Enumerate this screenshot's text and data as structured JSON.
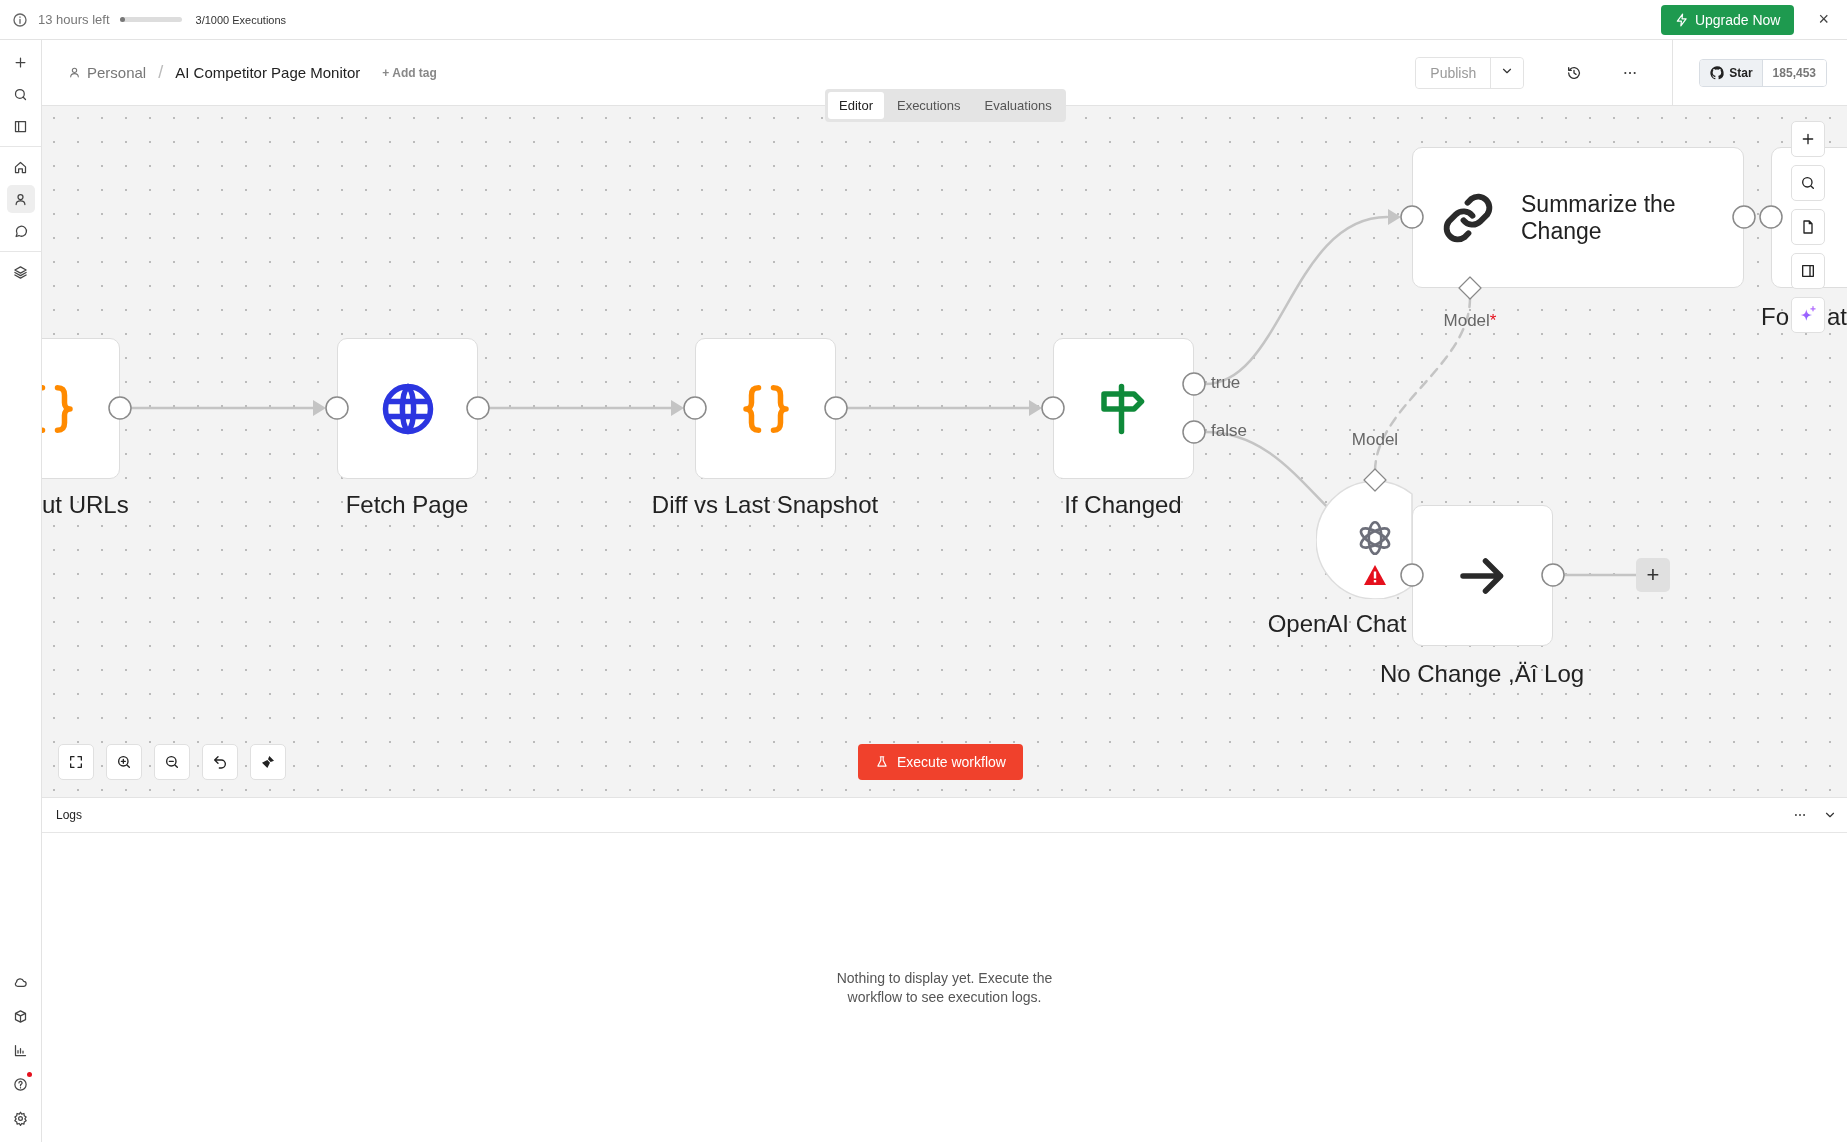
{
  "banner": {
    "trial_text": "13 hours left",
    "usage": {
      "level": 0.003,
      "text": "3/1000 Executions"
    },
    "upgrade_button": "Upgrade Now",
    "close": "×"
  },
  "sidebar": {
    "top": [
      {
        "kind": "add"
      },
      {
        "kind": "search"
      },
      {
        "kind": "panel"
      }
    ],
    "nav": [
      {
        "kind": "home",
        "selected": false
      },
      {
        "kind": "user",
        "selected": true
      },
      {
        "kind": "chat",
        "selected": false
      }
    ],
    "extra": [
      {
        "kind": "layers",
        "selected": false
      }
    ],
    "bottom": [
      {
        "kind": "cloud",
        "notification": false
      },
      {
        "kind": "package",
        "notification": false
      },
      {
        "kind": "chart",
        "notification": false
      },
      {
        "kind": "help",
        "notification": true
      },
      {
        "kind": "settings",
        "notification": false
      }
    ]
  },
  "header": {
    "project": "Personal",
    "separator": "/",
    "workflow": "AI Competitor Page Monitor",
    "add_tag": "+ Add tag",
    "publish_button": {
      "label": "Publish",
      "disabled": true
    },
    "star_button": "Star",
    "star_count": "185,453"
  },
  "view_tabs": [
    {
      "label": "Editor",
      "selected": true
    },
    {
      "label": "Executions",
      "selected": false
    },
    {
      "label": "Evaluations",
      "selected": false
    }
  ],
  "canvas": {
    "nodes": [
      {
        "kind": "code",
        "label": "ut URLs"
      },
      {
        "kind": "http",
        "label": "Fetch Page"
      },
      {
        "kind": "code",
        "label": "Diff vs Last Snapshot"
      },
      {
        "kind": "if",
        "label": "If Changed",
        "outputs": [
          "true",
          "false"
        ]
      },
      {
        "kind": "chain",
        "label": "Summarize the Change",
        "input_label": "Model",
        "required_mark": "*"
      },
      {
        "kind": "code",
        "label": "Fo",
        "label_tail": "at"
      },
      {
        "kind": "model",
        "label": "OpenAI Chat",
        "output_label": "Model",
        "warning": true
      },
      {
        "kind": "noop",
        "label": "No Change ,Äî Log"
      }
    ],
    "add_node": "+",
    "execute_button": "Execute workflow"
  },
  "logs": {
    "title": "Logs",
    "empty_message": "Nothing to display yet. Execute the workflow to see execution logs."
  }
}
